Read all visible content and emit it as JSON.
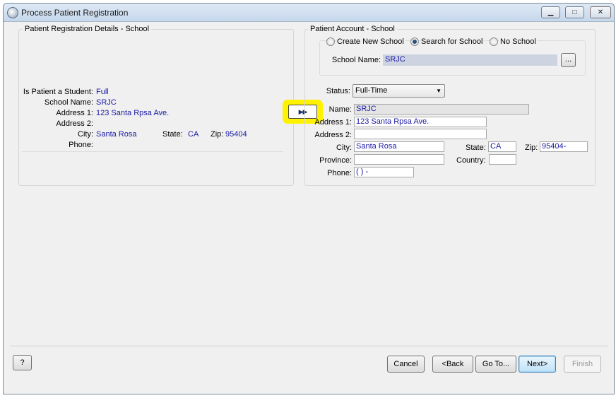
{
  "window": {
    "title": "Process Patient Registration"
  },
  "details": {
    "legend": "Patient Registration Details - School",
    "student_label": "Is Patient a Student:",
    "student_value": "Full",
    "school_label": "School Name:",
    "school_value": "SRJC",
    "address1_label": "Address 1:",
    "address1_value": "123 Santa Rpsa Ave.",
    "address2_label": "Address 2:",
    "address2_value": "",
    "city_label": "City:",
    "city_value": "Santa Rosa",
    "state_label": "State:",
    "state_value": "CA",
    "zip_label": "Zip:",
    "zip_value": "95404",
    "phone_label": "Phone:",
    "phone_value": ""
  },
  "copy_button": {
    "label": "▶▶"
  },
  "account": {
    "legend": "Patient Account - School",
    "radio_create": "Create New School",
    "radio_search": "Search for School",
    "radio_none": "No School",
    "school_name_label": "School Name:",
    "school_name_value": "SRJC",
    "browse_label": "...",
    "status_label": "Status:",
    "status_value": "Full-Time",
    "name_label": "Name:",
    "name_value": "SRJC",
    "address1_label": "Address 1:",
    "address1_value": "123 Santa Rpsa Ave.",
    "address2_label": "Address 2:",
    "address2_value": "",
    "city_label": "City:",
    "city_value": "Santa Rosa",
    "state_label": "State:",
    "state_value": "CA",
    "zip_label": "Zip:",
    "zip_value": "95404-",
    "province_label": "Province:",
    "province_value": "",
    "country_label": "Country:",
    "country_value": "",
    "phone_label": "Phone:",
    "phone_value": "(  )    -"
  },
  "footer": {
    "help": "?",
    "cancel": "Cancel",
    "back": "<Back",
    "goto": "Go To...",
    "next": "Next>",
    "finish": "Finish"
  }
}
